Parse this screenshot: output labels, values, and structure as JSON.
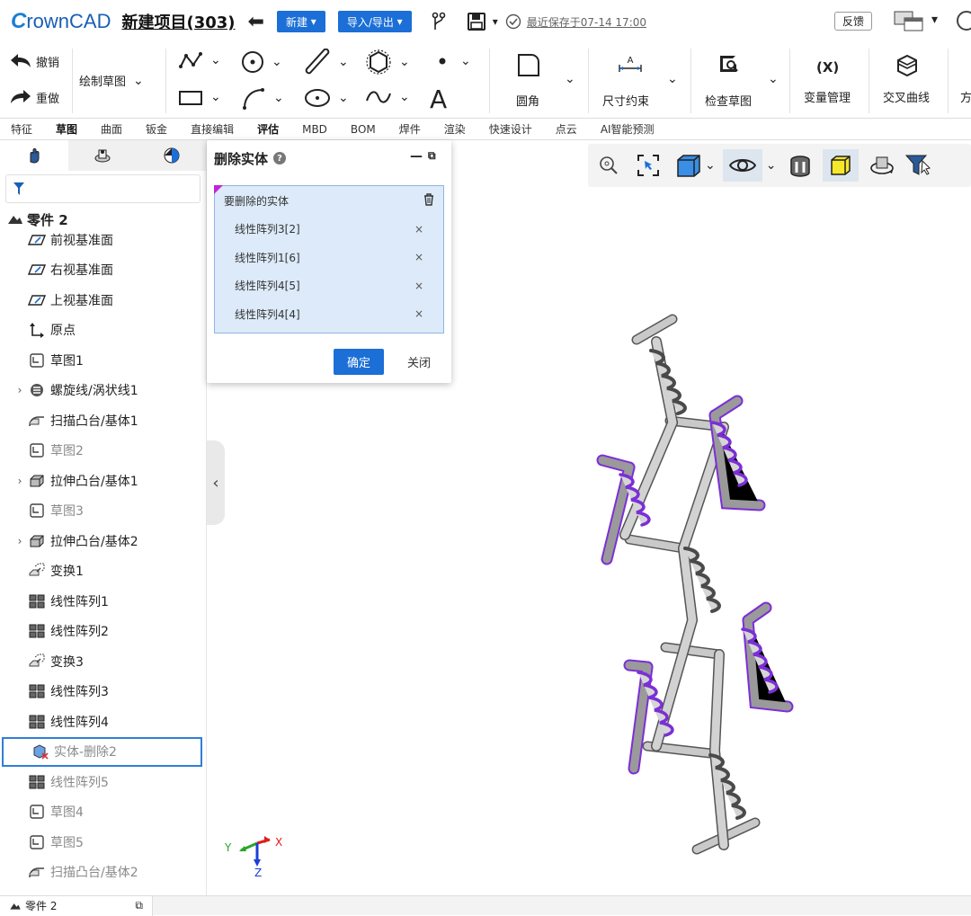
{
  "app": {
    "logo_c": "C",
    "logo_rest": "rownCAD",
    "project": "新建项目(303)"
  },
  "topbar": {
    "new_label": "新建",
    "import_export_label": "导入/导出",
    "saved": "最近保存于07-14 17:00",
    "feedback": "反馈"
  },
  "ribbon": {
    "undo": "撤销",
    "redo": "重做",
    "draw_sketch": "绘制草图",
    "fillet": "圆角",
    "dim_constraint": "尺寸约束",
    "check_sketch": "检查草图",
    "var_manage": "变量管理",
    "var_symbol": "(X)",
    "intersect_curve": "交叉曲线",
    "cut_text": "方"
  },
  "tabs": [
    "特征",
    "草图",
    "曲面",
    "钣金",
    "直接编辑",
    "评估",
    "MBD",
    "BOM",
    "焊件",
    "渲染",
    "快速设计",
    "点云",
    "AI智能预测"
  ],
  "tree": {
    "root": "零件 2",
    "items": [
      {
        "label": "前视基准面",
        "icon": "plane-icon",
        "gray": false,
        "arrow": ""
      },
      {
        "label": "右视基准面",
        "icon": "plane-icon",
        "gray": false,
        "arrow": ""
      },
      {
        "label": "上视基准面",
        "icon": "plane-icon",
        "gray": false,
        "arrow": ""
      },
      {
        "label": "原点",
        "icon": "origin-icon",
        "gray": false,
        "arrow": ""
      },
      {
        "label": "草图1",
        "icon": "sketch-icon",
        "gray": false,
        "arrow": ""
      },
      {
        "label": "螺旋线/涡状线1",
        "icon": "helix-icon",
        "gray": false,
        "arrow": "›"
      },
      {
        "label": "扫描凸台/基体1",
        "icon": "sweep-icon",
        "gray": false,
        "arrow": ""
      },
      {
        "label": "草图2",
        "icon": "sketch-icon",
        "gray": true,
        "arrow": ""
      },
      {
        "label": "拉伸凸台/基体1",
        "icon": "extrude-icon",
        "gray": false,
        "arrow": "›"
      },
      {
        "label": "草图3",
        "icon": "sketch-icon",
        "gray": true,
        "arrow": ""
      },
      {
        "label": "拉伸凸台/基体2",
        "icon": "extrude-icon",
        "gray": false,
        "arrow": "›"
      },
      {
        "label": "变换1",
        "icon": "transform-icon",
        "gray": false,
        "arrow": ""
      },
      {
        "label": "线性阵列1",
        "icon": "pattern-icon",
        "gray": false,
        "arrow": ""
      },
      {
        "label": "线性阵列2",
        "icon": "pattern-icon",
        "gray": false,
        "arrow": ""
      },
      {
        "label": "变换3",
        "icon": "transform-icon",
        "gray": false,
        "arrow": ""
      },
      {
        "label": "线性阵列3",
        "icon": "pattern-icon",
        "gray": false,
        "arrow": ""
      },
      {
        "label": "线性阵列4",
        "icon": "pattern-icon",
        "gray": false,
        "arrow": ""
      },
      {
        "label": "实体-删除2",
        "icon": "delete-body-icon",
        "gray": true,
        "arrow": "",
        "selected": true
      },
      {
        "label": "线性阵列5",
        "icon": "pattern-icon",
        "gray": true,
        "arrow": ""
      },
      {
        "label": "草图4",
        "icon": "sketch-icon",
        "gray": true,
        "arrow": ""
      },
      {
        "label": "草图5",
        "icon": "sketch-icon",
        "gray": true,
        "arrow": ""
      },
      {
        "label": "扫描凸台/基体2",
        "icon": "sweep-icon",
        "gray": true,
        "arrow": ""
      }
    ]
  },
  "dialog": {
    "title": "删除实体",
    "list_header": "要删除的实体",
    "entries": [
      "线性阵列3[2]",
      "线性阵列1[6]",
      "线性阵列4[5]",
      "线性阵列4[4]"
    ],
    "ok": "确定",
    "close": "关闭"
  },
  "axes": {
    "x": "X",
    "y": "Y",
    "z": "Z"
  },
  "status": {
    "tab": "零件 2"
  },
  "colors": {
    "accent": "#1b6fd6",
    "highlight": "#7b2fd6"
  }
}
